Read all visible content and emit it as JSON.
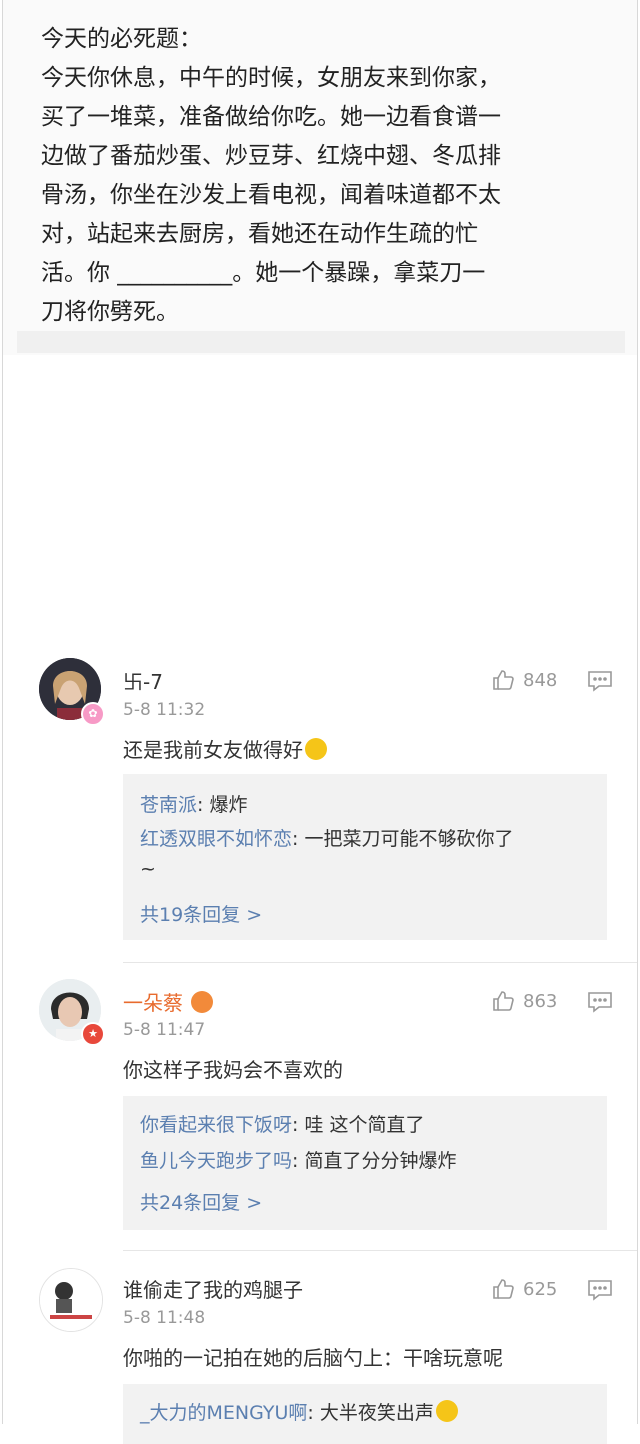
{
  "post": {
    "text": "今天的必死题：\n今天你休息，中午的时候，女朋友来到你家，\n买了一堆菜，准备做给你吃。她一边看食谱一\n边做了番茄炒蛋、炒豆芽、红烧中翅、冬瓜排\n骨汤，你坐在沙发上看电视，闻着味道都不太\n对，站起来去厨房，看她还在动作生疏的忙\n活。你 __________。她一个暴躁，拿菜刀一\n刀将你劈死。"
  },
  "comments": [
    {
      "username": "卐-7",
      "time": "5-8 11:32",
      "likes": "848",
      "content": "还是我前女友做得好",
      "replies": [
        {
          "user": "苍南派",
          "sep": ": ",
          "text": "爆炸"
        },
        {
          "user": "红透双眼不如怀恋",
          "sep": ": ",
          "text": "一把菜刀可能不够砍你了"
        },
        {
          "user": "",
          "sep": "",
          "text": "~"
        }
      ],
      "more": "共19条回复 >"
    },
    {
      "username": "一朵蔡",
      "time": "5-8 11:47",
      "likes": "863",
      "content": "你这样子我妈会不喜欢的",
      "replies": [
        {
          "user": "你看起来很下饭呀",
          "sep": ": ",
          "text": "哇 这个简直了"
        },
        {
          "user": "鱼儿今天跑步了吗",
          "sep": ": ",
          "text": "简直了分分钟爆炸"
        }
      ],
      "more": "共24条回复 >"
    },
    {
      "username": "谁偷走了我的鸡腿子",
      "time": "5-8 11:48",
      "likes": "625",
      "content": "你啪的一记拍在她的后脑勺上：干啥玩意呢",
      "replies": [
        {
          "user": "_大力的MENGYU啊",
          "sep": ": ",
          "text": "大半夜笑出声"
        }
      ]
    }
  ],
  "colors": {
    "link": "#5b7fb0",
    "username_vip": "#e86b2e",
    "meta": "#999999"
  }
}
